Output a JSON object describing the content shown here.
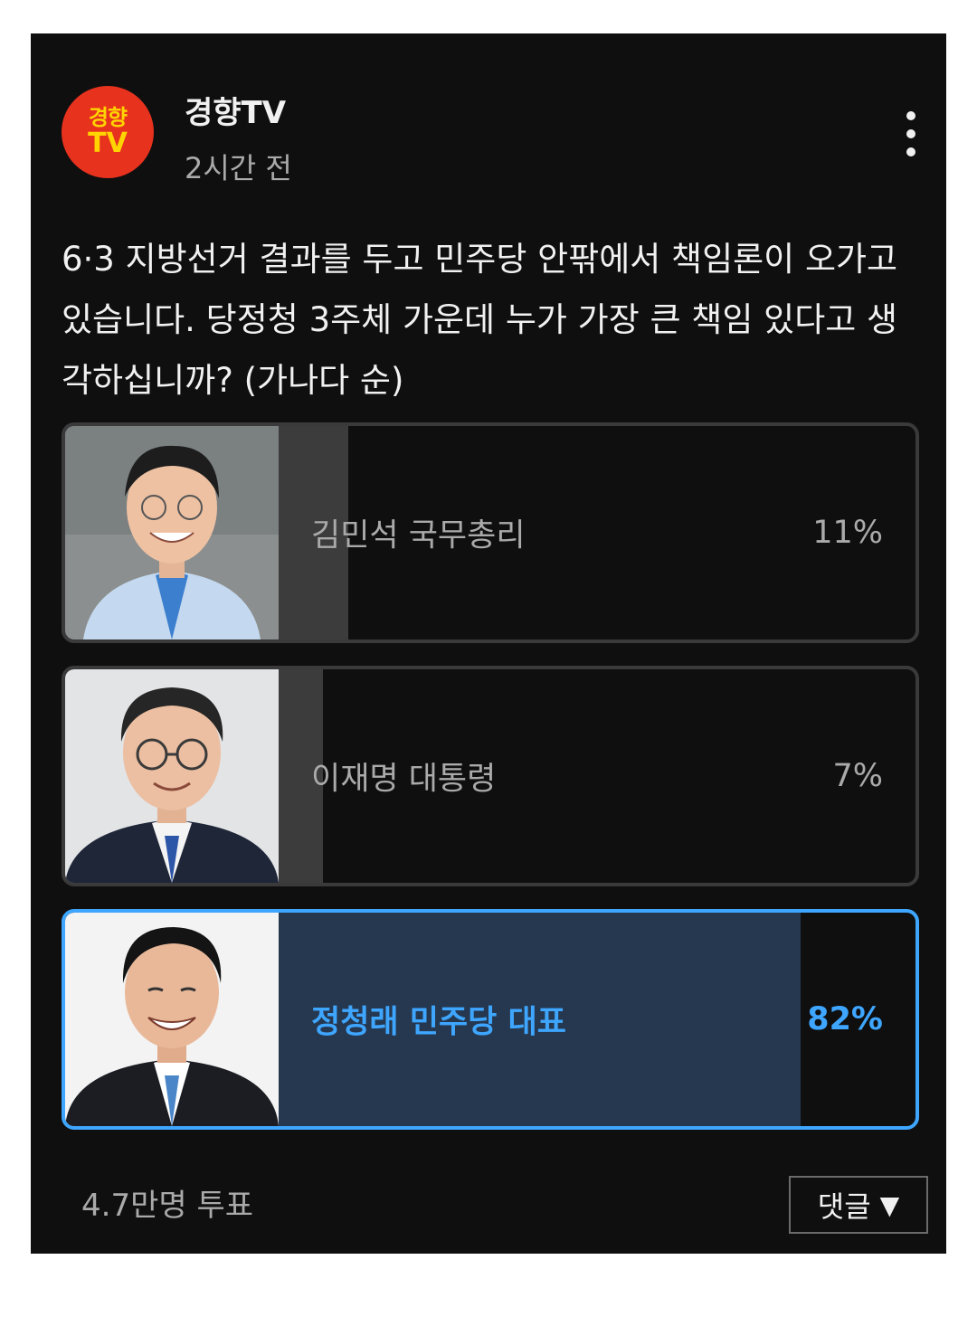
{
  "post": {
    "channel_name": "경향TV",
    "channel_logo_text_line1": "경향",
    "channel_logo_text_line2": "TV",
    "time_ago": "2시간 전",
    "question": "6·3 지방선거 결과를 두고 민주당 안팎에서 책임론이 오가고 있습니다. 당정청 3주체 가운데 누가 가장 큰 책임 있다고 생각하십니까? (가나다 순)"
  },
  "poll": {
    "options": [
      {
        "label": "김민석 국무총리",
        "percent_text": "11%",
        "percent": 11,
        "selected": false
      },
      {
        "label": "이재명 대통령",
        "percent_text": "7%",
        "percent": 7,
        "selected": false
      },
      {
        "label": "정청래 민주당 대표",
        "percent_text": "82%",
        "percent": 82,
        "selected": true
      }
    ],
    "vote_count": "4.7만명 투표"
  },
  "footer": {
    "comments_label": "댓글",
    "comments_arrow": "▼"
  },
  "colors": {
    "background": "#0f0f0f",
    "selected_accent": "#3ea6ff",
    "selected_fill": "#263850",
    "unselected_fill": "#3c3c3c",
    "logo_red": "#e7321e",
    "logo_yellow": "#ffd400"
  },
  "icons": {
    "more": "more-vert-icon",
    "comments_arrow": "triangle-down-icon"
  }
}
